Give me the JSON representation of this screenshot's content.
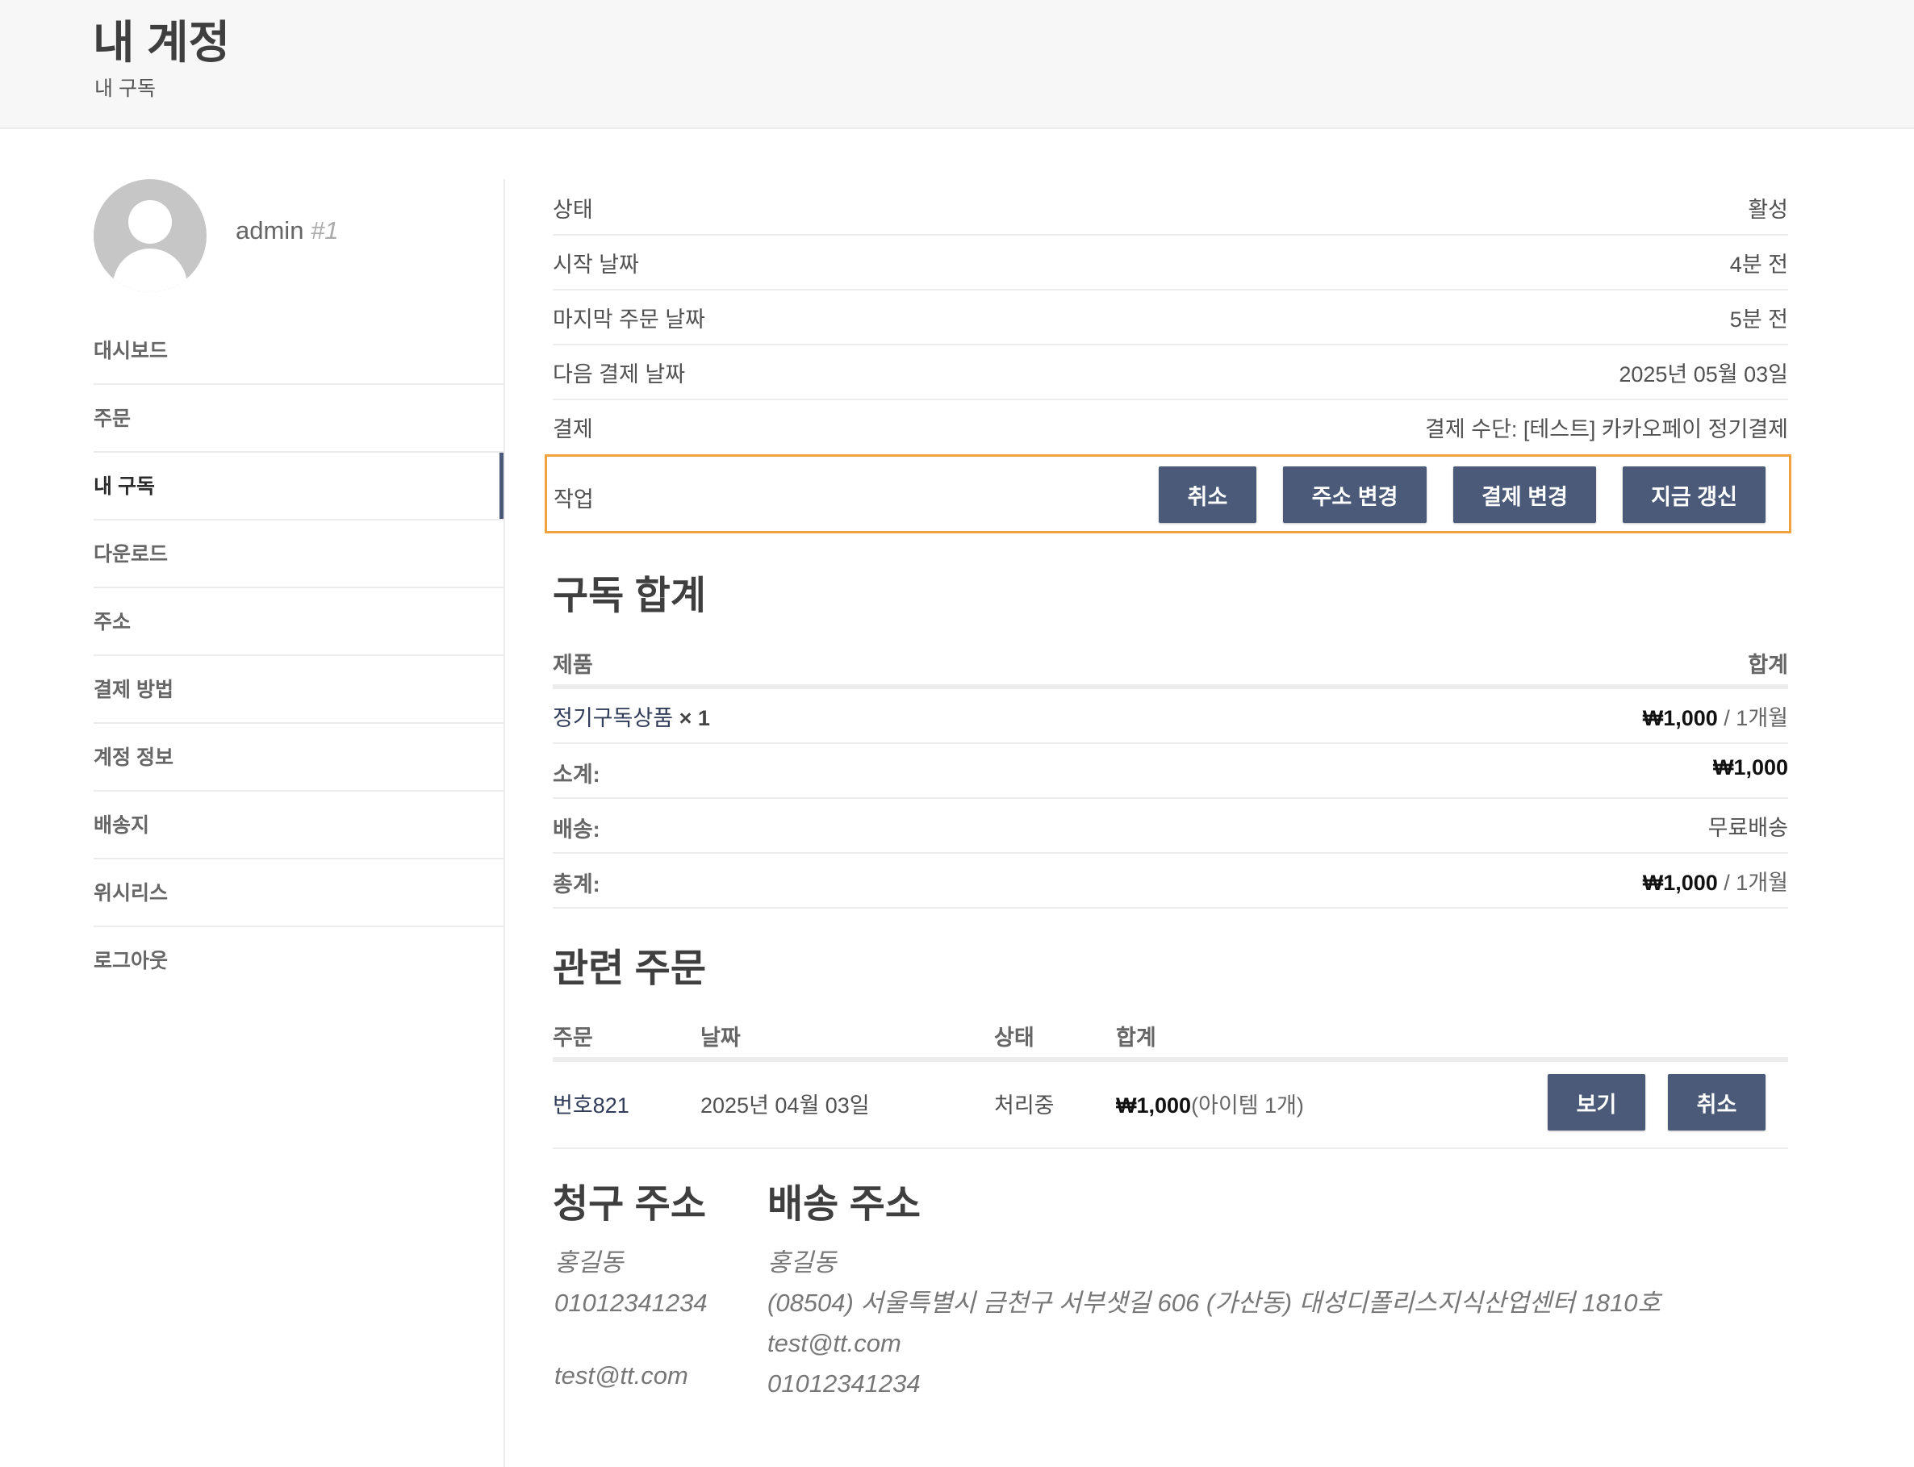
{
  "header": {
    "title": "내 계정",
    "subtitle": "내 구독"
  },
  "user": {
    "name": "admin",
    "id": "#1"
  },
  "sidebar": {
    "items": [
      {
        "label": "대시보드"
      },
      {
        "label": "주문"
      },
      {
        "label": "내 구독",
        "active": true
      },
      {
        "label": "다운로드"
      },
      {
        "label": "주소"
      },
      {
        "label": "결제 방법"
      },
      {
        "label": "계정 정보"
      },
      {
        "label": "배송지"
      },
      {
        "label": "위시리스"
      },
      {
        "label": "로그아웃"
      }
    ]
  },
  "subscription": {
    "rows": [
      {
        "label": "상태",
        "value": "활성"
      },
      {
        "label": "시작 날짜",
        "value": "4분 전"
      },
      {
        "label": "마지막 주문 날짜",
        "value": "5분 전"
      },
      {
        "label": "다음 결제 날짜",
        "value": "2025년 05월 03일"
      },
      {
        "label": "결제",
        "value": "결제 수단: [테스트] 카카오페이 정기결제"
      }
    ],
    "actions": {
      "label": "작업",
      "buttons": [
        {
          "label": "취소"
        },
        {
          "label": "주소 변경"
        },
        {
          "label": "결제 변경"
        },
        {
          "label": "지금 갱신"
        }
      ]
    }
  },
  "totals": {
    "heading": "구독 합계",
    "col_product": "제품",
    "col_total": "합계",
    "product": {
      "name": "정기구독상품",
      "qty": "× 1",
      "price": "₩1,000",
      "period": "/ 1개월"
    },
    "subtotal": {
      "label": "소계:",
      "value": "₩1,000"
    },
    "shipping": {
      "label": "배송:",
      "value": "무료배송"
    },
    "total": {
      "label": "총계:",
      "price": "₩1,000",
      "period": "/ 1개월"
    }
  },
  "related": {
    "heading": "관련 주문",
    "cols": [
      "주문",
      "날짜",
      "상태",
      "합계"
    ],
    "order": {
      "number": "번호821",
      "date": "2025년 04월 03일",
      "status": "처리중",
      "total": "₩1,000",
      "items": "(아이템 1개)",
      "view": "보기",
      "cancel": "취소"
    }
  },
  "billing": {
    "heading": "청구 주소",
    "name": "홍길동",
    "phone": "01012341234",
    "email": "test@tt.com"
  },
  "shipping": {
    "heading": "배송 주소",
    "name": "홍길동",
    "address": "(08504) 서울특별시 금천구 서부샛길 606 (가산동) 대성디폴리스지식산업센터 1810호",
    "email": "test@tt.com",
    "phone": "01012341234"
  },
  "colors": {
    "button": "#4a5a78",
    "highlight": "#f2a33d"
  }
}
